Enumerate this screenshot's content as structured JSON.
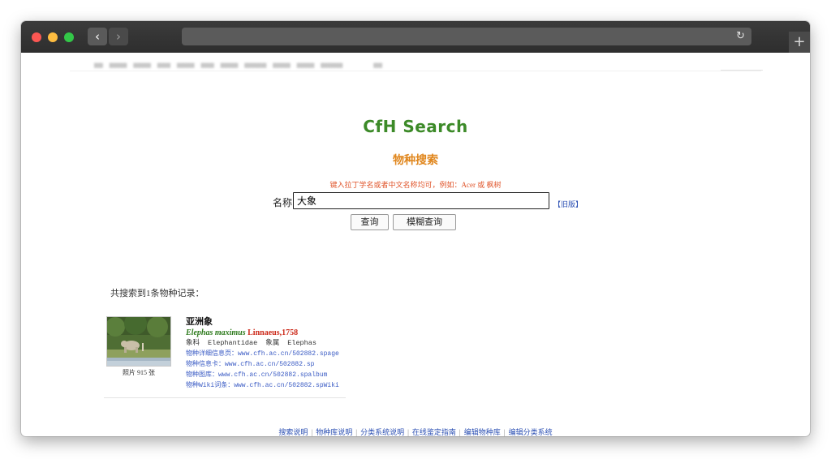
{
  "browser": {
    "back_icon": "chevron-left-icon",
    "forward_icon": "chevron-right-icon",
    "reload_icon": "reload-icon",
    "newtab_label": "+"
  },
  "site": {
    "logo": "CfH Search",
    "subtitle": "物种搜索",
    "hint": "键入拉丁学名或者中文名称均可，例如：Acer 或 枫树",
    "name_label": "名称",
    "search_value": "大象",
    "old_version": "【旧版】",
    "query_button": "查询",
    "fuzzy_button": "模糊查询"
  },
  "results": {
    "count_text": "共搜索到1条物种记录：",
    "items": [
      {
        "chinese_name": "亚洲象",
        "scientific_name": "Elephas maximus",
        "author": "Linnaeus,1758",
        "family_cn": "象科",
        "family_latin": "Elephantidae",
        "genus_cn": "象属",
        "genus_latin": "Elephas",
        "photo_count": "照片 915 张",
        "links": [
          "物种详细信息页：www.cfh.ac.cn/502882.spage",
          "物种信息卡：www.cfh.ac.cn/502882.sp",
          "物种图库：www.cfh.ac.cn/502882.spalbum",
          "物种Wiki词条：www.cfh.ac.cn/502882.spWiki"
        ]
      }
    ]
  },
  "footer": {
    "links": [
      "搜索说明",
      "物种库说明",
      "分类系统说明",
      "在线鉴定指南",
      "编辑物种库",
      "编辑分类系统"
    ]
  },
  "colors": {
    "logo": "#3c8a28",
    "subtitle": "#e0861c",
    "hint": "#e0552b",
    "link": "#3a5bc4"
  }
}
